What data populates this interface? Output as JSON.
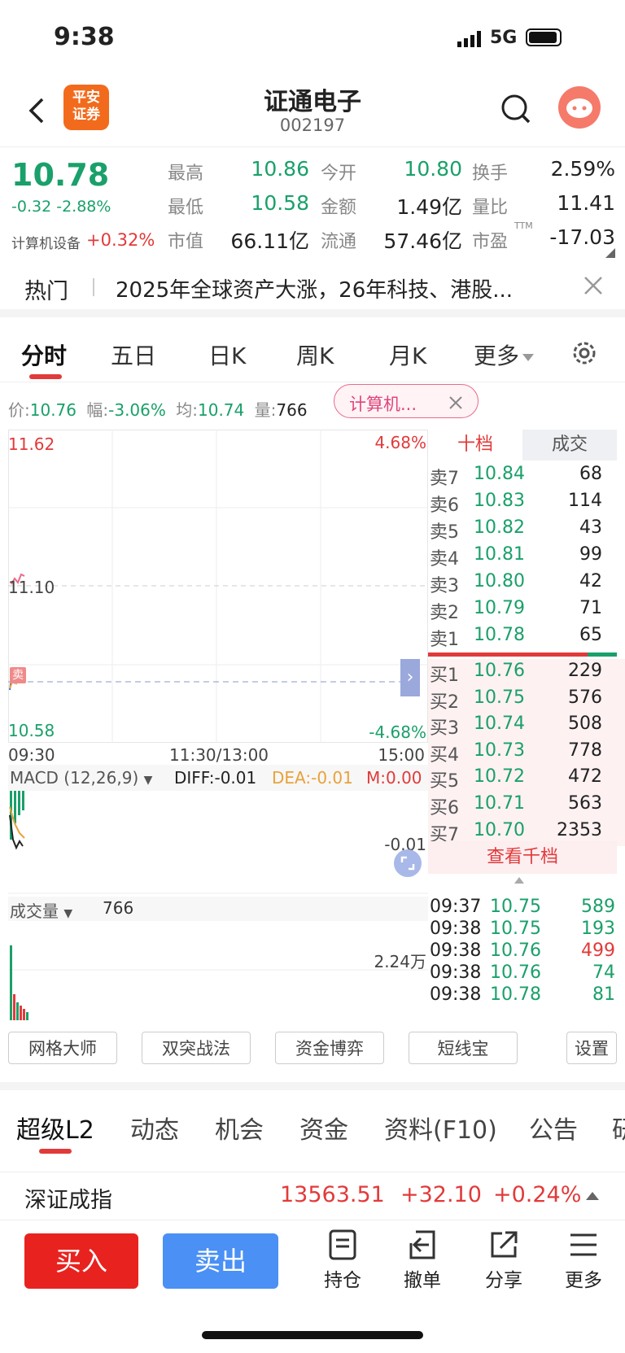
{
  "status": {
    "time": "9:38",
    "network": "5G"
  },
  "header": {
    "brand": "平安\n证券",
    "brand_line1": "平安",
    "brand_line2": "证券",
    "name": "证通电子",
    "code": "002197"
  },
  "quote": {
    "price": "10.78",
    "change": "-0.32",
    "pct": "-2.88%",
    "sector_name": "计算机设备",
    "sector_pct": "+0.32%",
    "cols": [
      {
        "l1": "最高",
        "v1": "10.86",
        "l2": "最低",
        "v2": "10.58",
        "l3": "市值",
        "v3": "66.11亿"
      },
      {
        "l1": "今开",
        "v1": "10.80",
        "l2": "金额",
        "v2": "1.49亿",
        "l3": "流通",
        "v3": "57.46亿"
      },
      {
        "l1": "换手",
        "v1": "2.59%",
        "l2": "量比",
        "v2": "11.41",
        "l3": "市盈",
        "v3": "-17.03",
        "ttm": "TTM"
      }
    ]
  },
  "hot": {
    "tag": "热门",
    "text": "2025年全球资产大涨，26年科技、港股..."
  },
  "chart_tabs": [
    "分时",
    "五日",
    "日K",
    "周K",
    "月K",
    "更多"
  ],
  "info": {
    "price_label": "价:",
    "price": "10.76",
    "amp_label": "幅:",
    "amp": "-3.06%",
    "avg_label": "均:",
    "avg": "10.74",
    "vol_label": "量:",
    "vol": "766",
    "chip": "计算机..."
  },
  "chart": {
    "y_top": "11.62",
    "y_mid": "11.10",
    "y_bot": "10.58",
    "pct_top": "4.68%",
    "pct_bot": "-4.68%",
    "x_start": "09:30",
    "x_mid": "11:30/13:00",
    "x_end": "15:00",
    "sell_tag": "卖"
  },
  "macd": {
    "label": "MACD (12,26,9)",
    "diff": "DIFF:-0.01",
    "dea": "DEA:-0.01",
    "m": "M:0.00",
    "val": "-0.01"
  },
  "volume": {
    "label": "成交量",
    "val": "766",
    "scale": "2.24万"
  },
  "orderbook": {
    "tab1": "十档",
    "tab2": "成交",
    "asks": [
      {
        "l": "卖7",
        "p": "10.84",
        "q": "68"
      },
      {
        "l": "卖6",
        "p": "10.83",
        "q": "114"
      },
      {
        "l": "卖5",
        "p": "10.82",
        "q": "43"
      },
      {
        "l": "卖4",
        "p": "10.81",
        "q": "99"
      },
      {
        "l": "卖3",
        "p": "10.80",
        "q": "42"
      },
      {
        "l": "卖2",
        "p": "10.79",
        "q": "71"
      },
      {
        "l": "卖1",
        "p": "10.78",
        "q": "65"
      }
    ],
    "bids": [
      {
        "l": "买1",
        "p": "10.76",
        "q": "229"
      },
      {
        "l": "买2",
        "p": "10.75",
        "q": "576"
      },
      {
        "l": "买3",
        "p": "10.74",
        "q": "508"
      },
      {
        "l": "买4",
        "p": "10.73",
        "q": "778"
      },
      {
        "l": "买5",
        "p": "10.72",
        "q": "472"
      },
      {
        "l": "买6",
        "p": "10.71",
        "q": "563"
      },
      {
        "l": "买7",
        "p": "10.70",
        "q": "2353"
      }
    ],
    "view_more": "查看千档",
    "trades": [
      {
        "t": "09:37",
        "p": "10.75",
        "q": "589"
      },
      {
        "t": "09:38",
        "p": "10.75",
        "q": "193"
      },
      {
        "t": "09:38",
        "p": "10.76",
        "q": "499"
      },
      {
        "t": "09:38",
        "p": "10.76",
        "q": "74"
      },
      {
        "t": "09:38",
        "p": "10.78",
        "q": "81"
      }
    ]
  },
  "tools": [
    "网格大师",
    "双突战法",
    "资金博弈",
    "短线宝",
    "设置"
  ],
  "section_tabs": [
    "超级L2",
    "动态",
    "机会",
    "资金",
    "资料(F10)",
    "公告",
    "研"
  ],
  "index": {
    "name": "深证成指",
    "value": "13563.51",
    "change": "+32.10",
    "pct": "+0.24%"
  },
  "bottom": {
    "buy": "买入",
    "sell": "卖出",
    "items": [
      "持仓",
      "撤单",
      "分享",
      "更多"
    ]
  },
  "colors": {
    "green": "#1aa06a",
    "red": "#e23a3a",
    "blue": "#4a90f5",
    "brand": "#f26b1d"
  }
}
